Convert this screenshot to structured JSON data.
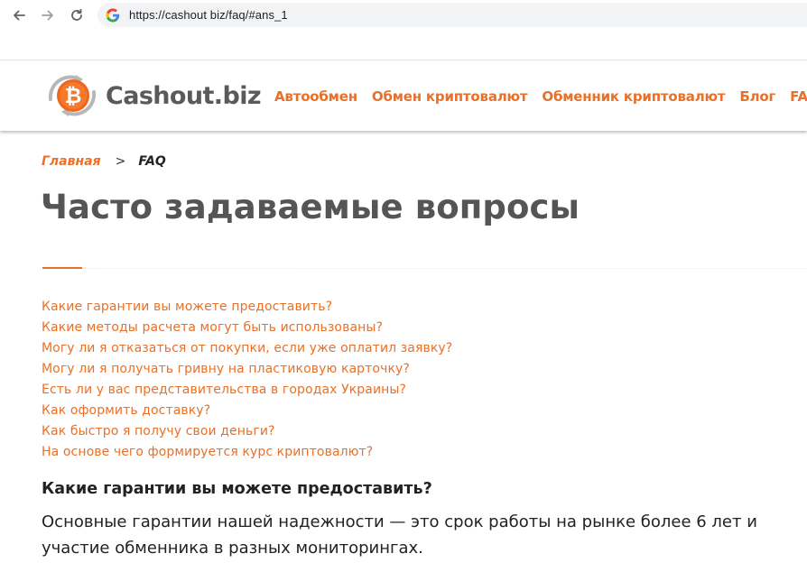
{
  "browser": {
    "url": "https://cashout biz/faq/#ans_1"
  },
  "header": {
    "logo_text": "Cashout.biz",
    "nav": [
      {
        "label": "Автообмен"
      },
      {
        "label": "Обмен криптовалют"
      },
      {
        "label": "Обменник криптовалют"
      },
      {
        "label": "Блог"
      },
      {
        "label": "FAQ"
      }
    ]
  },
  "breadcrumb": {
    "home": "Главная",
    "separator": ">",
    "current": "FAQ"
  },
  "page": {
    "title": "Часто задаваемые вопросы"
  },
  "faq": {
    "questions": [
      "Какие гарантии вы можете предоставить?",
      "Какие методы расчета могут быть использованы?",
      "Могу ли я отказаться от покупки, если уже оплатил заявку?",
      "Могу ли я получать гривну на пластиковую карточку?",
      "Есть ли у вас представительства в городах Украины?",
      "Как оформить доставку?",
      "Как быстро я получу свои деньги?",
      "На основе чего формируется курс криптовалют?"
    ],
    "answer_heading": "Какие гарантии вы можете предоставить?",
    "answer_text": "Основные гарантии нашей надежности — это срок работы на рынке более 6 лет и участие обменника в разных мониторингах."
  },
  "colors": {
    "accent": "#e8712a",
    "title_gray": "#555555",
    "text": "#222222"
  },
  "icons": {
    "back": "arrow-left-icon",
    "forward": "arrow-right-icon",
    "reload": "reload-icon",
    "site_info": "google-g-icon",
    "logo": "bitcoin-coin-icon"
  }
}
